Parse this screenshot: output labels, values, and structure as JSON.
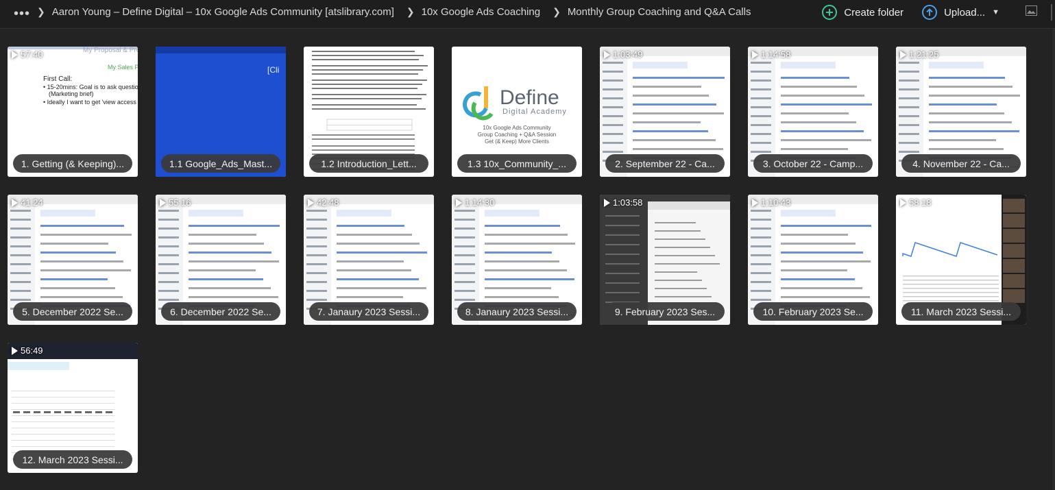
{
  "header": {
    "breadcrumbs": [
      "Aaron Young – Define Digital – 10x Google Ads Community [atslibrary.com]",
      "10x Google Ads Coaching",
      "Monthly Group Coaching and Q&A Calls"
    ],
    "create_folder_label": "Create folder",
    "upload_label": "Upload...",
    "accent_green": "#3fc79a",
    "accent_blue": "#4a9fe8"
  },
  "define_logo": {
    "brand": "Define",
    "sub": "Digital Academy",
    "caption_lines": [
      "10x Google Ads Community",
      "Group Coaching + Q&A Session",
      "Get (& Keep) More Clients"
    ]
  },
  "items": [
    {
      "title": "1. Getting (& Keeping)...",
      "duration": "57:40",
      "kind": "slide"
    },
    {
      "title": "1.1 Google_Ads_Mast...",
      "duration": "",
      "kind": "blue"
    },
    {
      "title": "1.2 Introduction_Lett...",
      "duration": "",
      "kind": "doc"
    },
    {
      "title": "1.3 10x_Community_...",
      "duration": "",
      "kind": "logo"
    },
    {
      "title": "2. September 22 - Ca...",
      "duration": "1:03:49",
      "kind": "ads"
    },
    {
      "title": "3. October 22 - Camp...",
      "duration": "1:14:58",
      "kind": "ads"
    },
    {
      "title": "4. November 22 - Ca...",
      "duration": "1:21:25",
      "kind": "ads"
    },
    {
      "title": "5. December 2022 Se...",
      "duration": "41:24",
      "kind": "ads"
    },
    {
      "title": "6. December 2022 Se...",
      "duration": "55:16",
      "kind": "ads"
    },
    {
      "title": "7. Janaury 2023 Sessi...",
      "duration": "42:48",
      "kind": "ads"
    },
    {
      "title": "8. Janaury 2023 Sessi...",
      "duration": "1:14:30",
      "kind": "ads"
    },
    {
      "title": "9. February 2023 Ses...",
      "duration": "1:03:58",
      "kind": "dark"
    },
    {
      "title": "10. February 2023 Se...",
      "duration": "1:10:43",
      "kind": "ads"
    },
    {
      "title": "11. March 2023 Sessi...",
      "duration": "58:18",
      "kind": "chart"
    },
    {
      "title": "12. March 2023 Sessi...",
      "duration": "56:49",
      "kind": "table"
    }
  ]
}
